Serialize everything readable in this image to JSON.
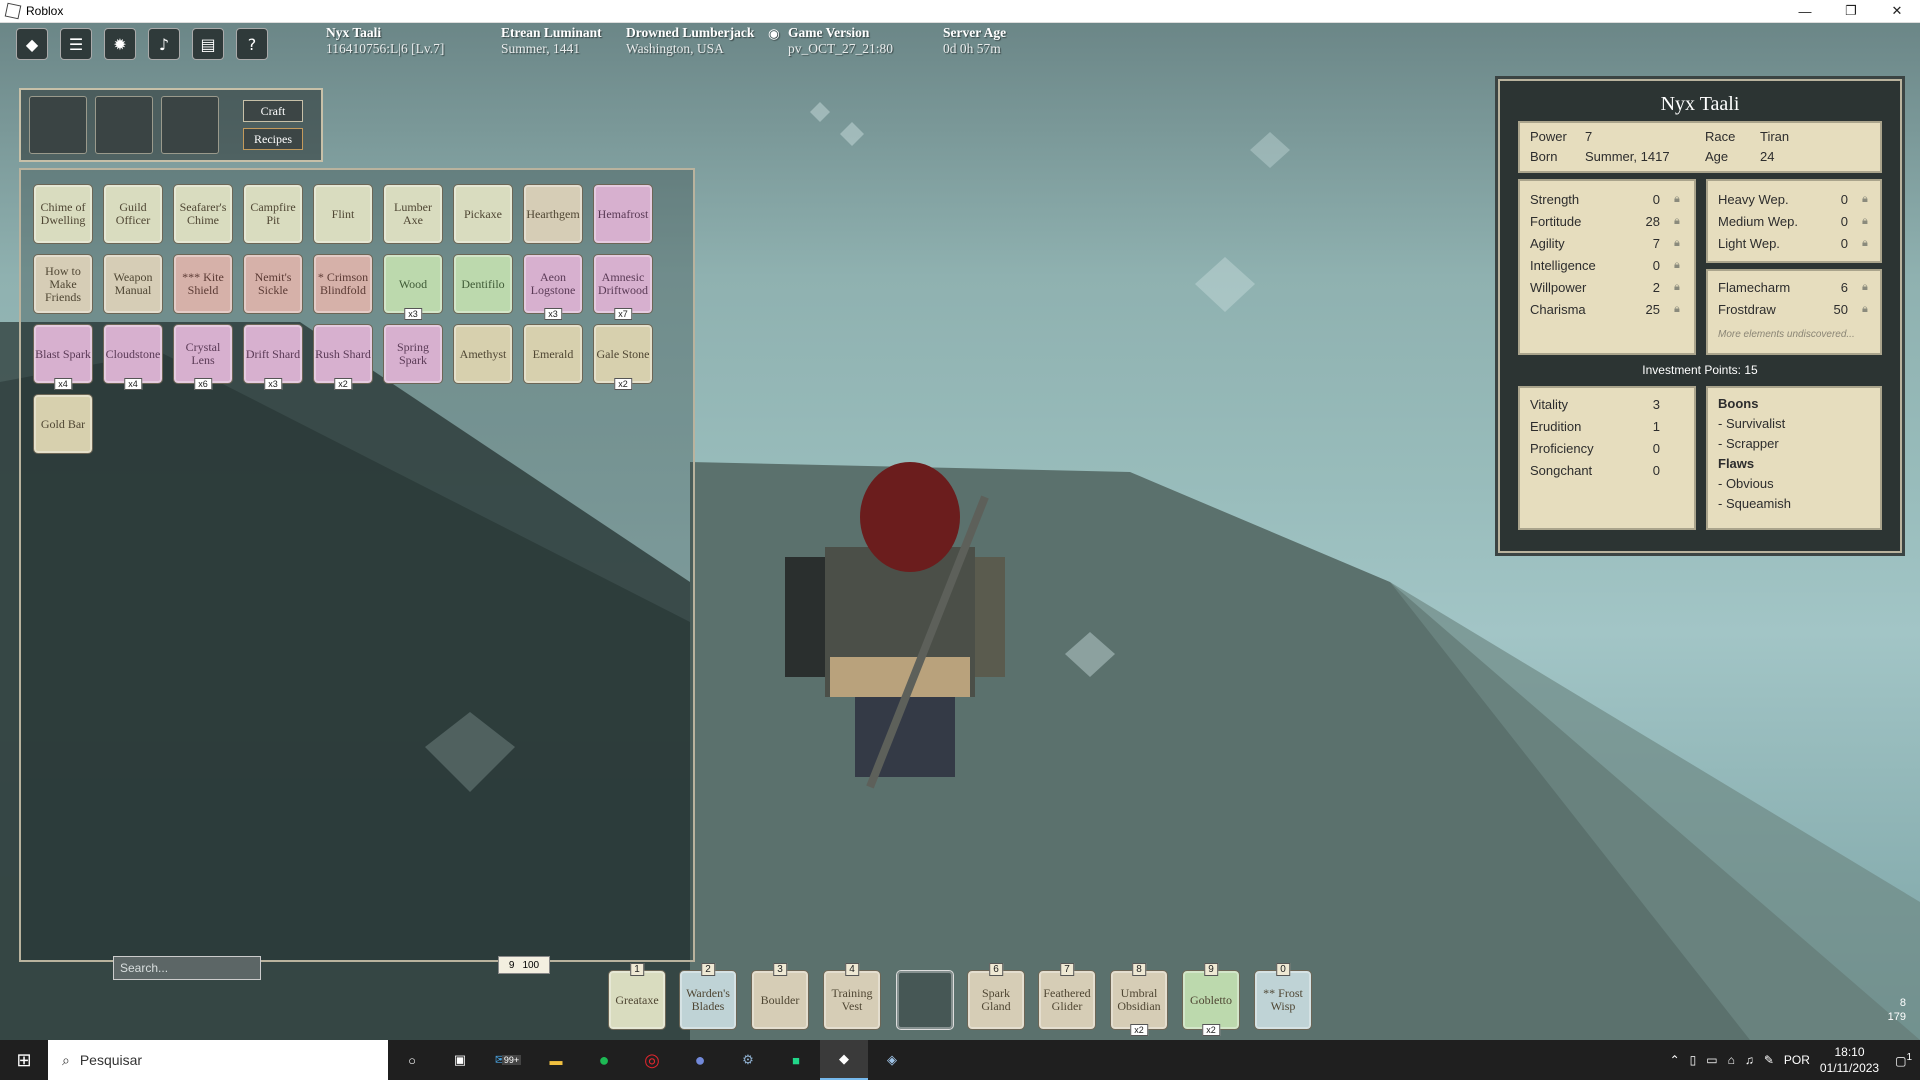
{
  "window": {
    "title": "Roblox",
    "minimize": "—",
    "restore": "❐",
    "close": "✕"
  },
  "hud": {
    "player_name": "Nyx Taali",
    "player_id": "116410756:L|6 [Lv.7]",
    "region": "Etrean Luminant",
    "date": "Summer, 1441",
    "server": "Drowned Lumberjack",
    "location": "Washington, USA",
    "game_version_label": "Game Version",
    "game_version": "pv_OCT_27_21:80",
    "server_age_label": "Server Age",
    "server_age": "0d 0h 57m"
  },
  "craft": {
    "craft_label": "Craft",
    "recipes_label": "Recipes"
  },
  "inventory": {
    "items": [
      {
        "label": "Chime of Dwelling",
        "style": "g",
        "count": ""
      },
      {
        "label": "Guild Officer",
        "style": "g",
        "count": ""
      },
      {
        "label": "Seafarer's Chime",
        "style": "g",
        "count": ""
      },
      {
        "label": "Campfire Pit",
        "style": "g",
        "count": ""
      },
      {
        "label": "Flint",
        "style": "g",
        "count": ""
      },
      {
        "label": "Lumber Axe",
        "style": "g",
        "count": ""
      },
      {
        "label": "Pickaxe",
        "style": "g",
        "count": ""
      },
      {
        "label": "Hearthgem",
        "style": "t",
        "count": ""
      },
      {
        "label": "Hemafrost",
        "style": "p",
        "count": ""
      },
      {
        "label": "How to Make Friends",
        "style": "t",
        "count": ""
      },
      {
        "label": "Weapon Manual",
        "style": "t",
        "count": ""
      },
      {
        "label": "*** Kite Shield",
        "style": "r",
        "count": ""
      },
      {
        "label": "Nemit's Sickle",
        "style": "r",
        "count": ""
      },
      {
        "label": "* Crimson Blindfold",
        "style": "r",
        "count": ""
      },
      {
        "label": "Wood",
        "style": "m",
        "count": "x3"
      },
      {
        "label": "Dentifilo",
        "style": "m",
        "count": ""
      },
      {
        "label": "Aeon Logstone",
        "style": "p",
        "count": "x3"
      },
      {
        "label": "Amnesic Driftwood",
        "style": "p",
        "count": "x7"
      },
      {
        "label": "Blast Spark",
        "style": "p",
        "count": "x4"
      },
      {
        "label": "Cloudstone",
        "style": "p",
        "count": "x4"
      },
      {
        "label": "Crystal Lens",
        "style": "p",
        "count": "x6"
      },
      {
        "label": "Drift Shard",
        "style": "p",
        "count": "x3"
      },
      {
        "label": "Rush Shard",
        "style": "p",
        "count": "x2"
      },
      {
        "label": "Spring Spark",
        "style": "p",
        "count": ""
      },
      {
        "label": "Amethyst",
        "style": "y",
        "count": ""
      },
      {
        "label": "Emerald",
        "style": "y",
        "count": ""
      },
      {
        "label": "Gale Stone",
        "style": "y",
        "count": "x2"
      },
      {
        "label": "Gold Bar",
        "style": "y",
        "count": ""
      }
    ],
    "search_placeholder": "Search...",
    "capacity_used": "9",
    "capacity_max": "100"
  },
  "hotbar": [
    {
      "num": "1",
      "label": "Greataxe",
      "style": "g"
    },
    {
      "num": "2",
      "label": "Warden's Blades",
      "style": "b"
    },
    {
      "num": "3",
      "label": "Boulder",
      "style": "t"
    },
    {
      "num": "4",
      "label": "Training Vest",
      "style": "t"
    },
    {
      "num": "",
      "label": "",
      "style": "empty"
    },
    {
      "num": "6",
      "label": "Spark Gland",
      "style": "t"
    },
    {
      "num": "7",
      "label": "Feathered Glider",
      "style": "t"
    },
    {
      "num": "8",
      "label": "Umbral Obsidian",
      "style": "t",
      "count": "x2"
    },
    {
      "num": "9",
      "label": "Gobletto",
      "style": "m",
      "count": "x2"
    },
    {
      "num": "0",
      "label": "** Frost Wisp",
      "style": "b"
    }
  ],
  "sheet": {
    "name": "Nyx Taali",
    "power_label": "Power",
    "power": "7",
    "race_label": "Race",
    "race": "Tiran",
    "born_label": "Born",
    "born": "Summer, 1417",
    "age_label": "Age",
    "age": "24",
    "attributes": [
      {
        "label": "Strength",
        "value": "0"
      },
      {
        "label": "Fortitude",
        "value": "28"
      },
      {
        "label": "Agility",
        "value": "7"
      },
      {
        "label": "Intelligence",
        "value": "0"
      },
      {
        "label": "Willpower",
        "value": "2"
      },
      {
        "label": "Charisma",
        "value": "25"
      }
    ],
    "weapons": [
      {
        "label": "Heavy Wep.",
        "value": "0"
      },
      {
        "label": "Medium Wep.",
        "value": "0"
      },
      {
        "label": "Light Wep.",
        "value": "0"
      }
    ],
    "elements": [
      {
        "label": "Flamecharm",
        "value": "6"
      },
      {
        "label": "Frostdraw",
        "value": "50"
      }
    ],
    "elements_note": "More elements undiscovered...",
    "investment_points": "Investment Points: 15",
    "investments": [
      {
        "label": "Vitality",
        "value": "3"
      },
      {
        "label": "Erudition",
        "value": "1"
      },
      {
        "label": "Proficiency",
        "value": "0"
      },
      {
        "label": "Songchant",
        "value": "0"
      }
    ],
    "boons_label": "Boons",
    "boons": [
      "- Survivalist",
      "- Scrapper"
    ],
    "flaws_label": "Flaws",
    "flaws": [
      "- Obvious",
      "- Squeamish"
    ]
  },
  "corner": {
    "line1": "8",
    "line2": "179"
  },
  "taskbar": {
    "search_placeholder": "Pesquisar",
    "mail_badge": "99+",
    "language": "POR",
    "time": "18:10",
    "date": "01/11/2023",
    "notifications": "1"
  },
  "colors": {
    "accent": "#b9b39e",
    "panel": "#e6ddbe",
    "sheet_bg": "#2c3433"
  }
}
